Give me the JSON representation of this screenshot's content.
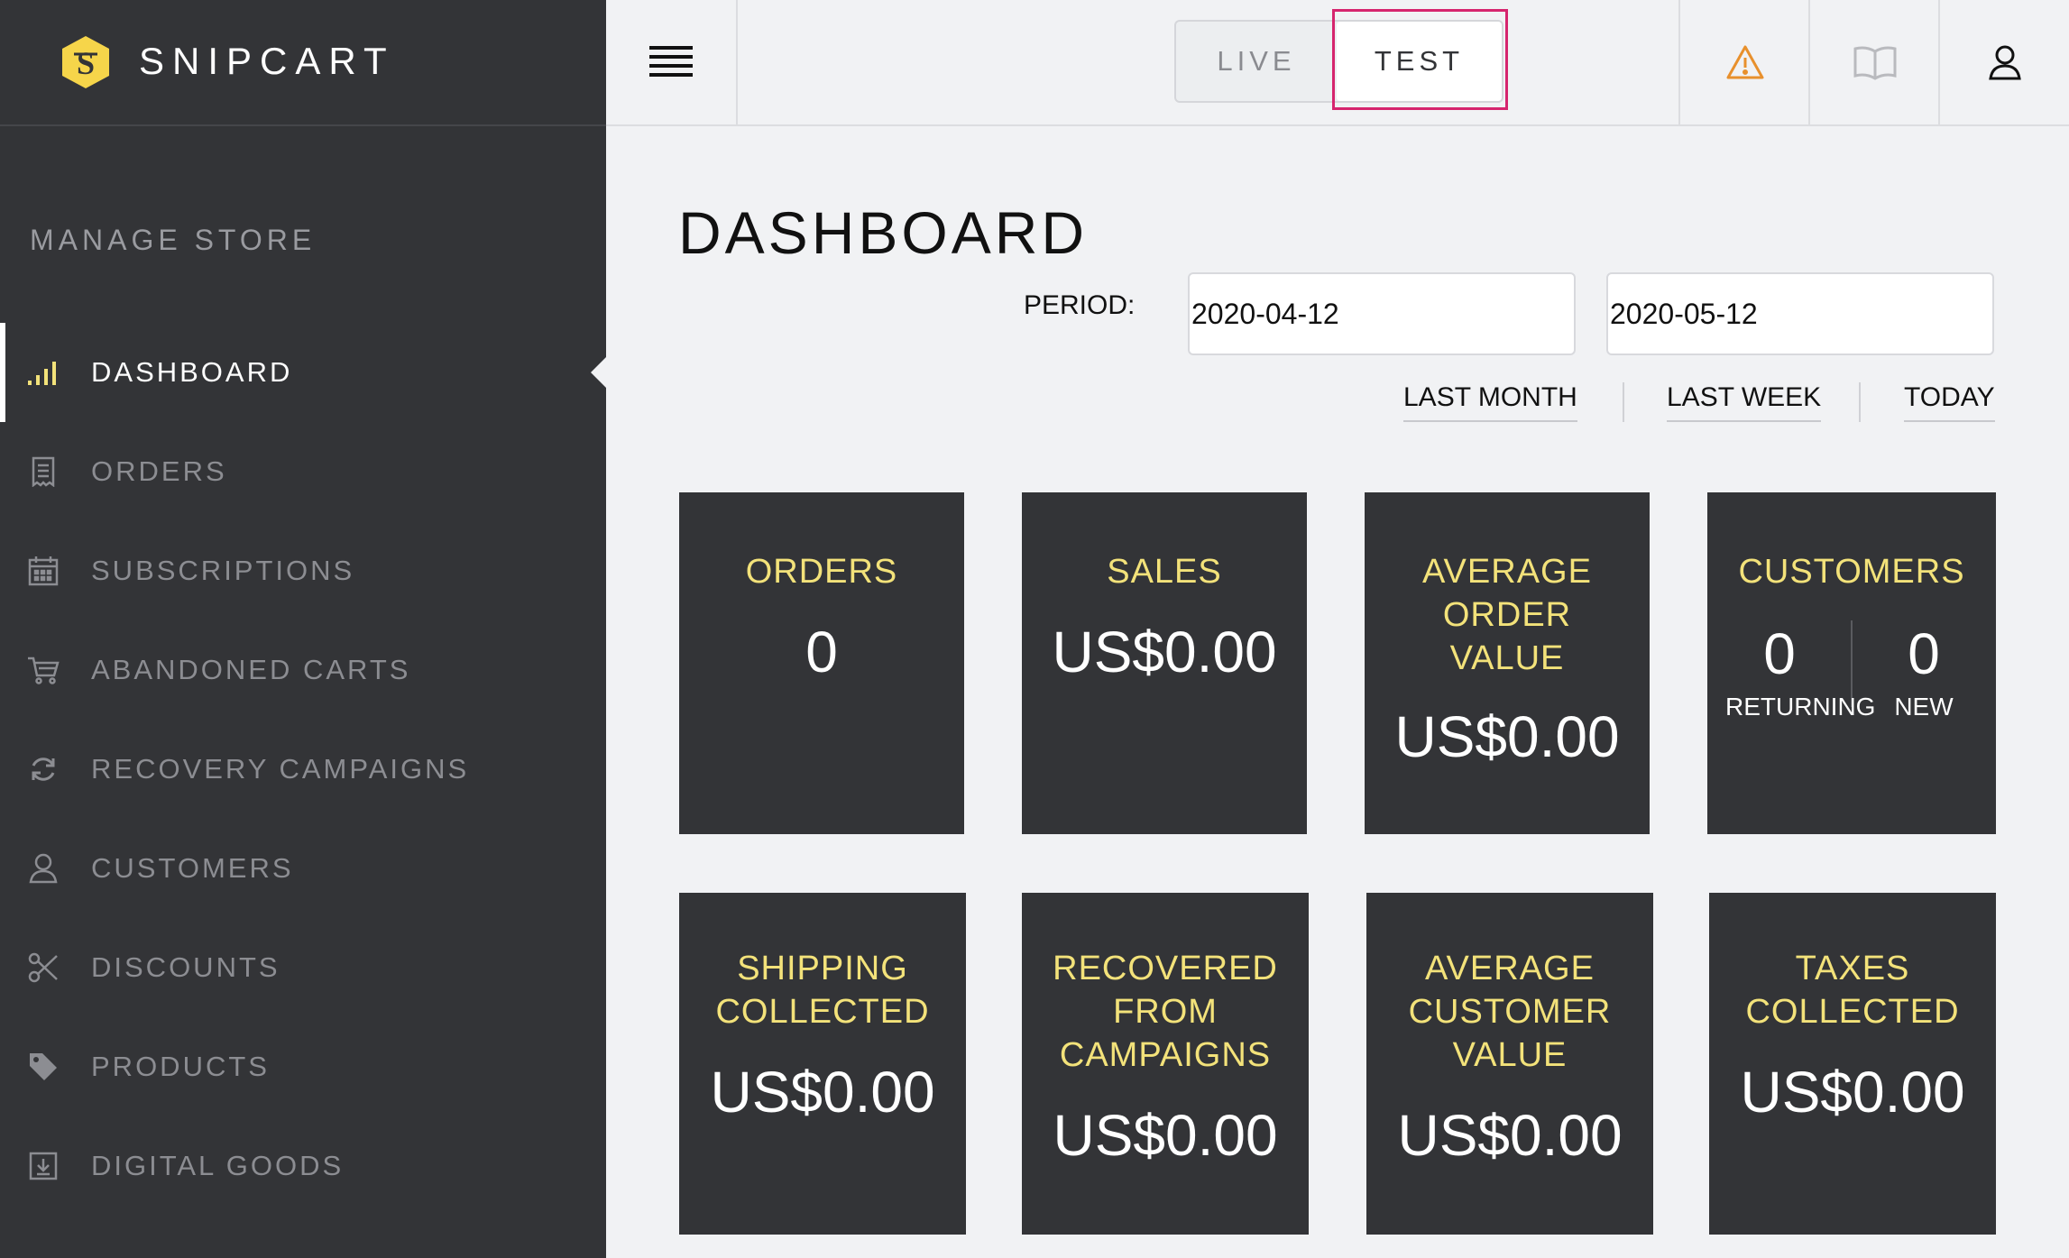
{
  "brand": {
    "name": "SNIPCART"
  },
  "sidebar": {
    "section_title": "MANAGE STORE",
    "items": [
      {
        "label": "DASHBOARD",
        "icon": "bar-chart-icon",
        "active": true
      },
      {
        "label": "ORDERS",
        "icon": "receipt-icon"
      },
      {
        "label": "SUBSCRIPTIONS",
        "icon": "calendar-icon"
      },
      {
        "label": "ABANDONED CARTS",
        "icon": "cart-icon"
      },
      {
        "label": "RECOVERY CAMPAIGNS",
        "icon": "refresh-icon"
      },
      {
        "label": "CUSTOMERS",
        "icon": "user-icon"
      },
      {
        "label": "DISCOUNTS",
        "icon": "scissors-icon"
      },
      {
        "label": "PRODUCTS",
        "icon": "tag-icon"
      },
      {
        "label": "DIGITAL GOODS",
        "icon": "download-icon"
      }
    ]
  },
  "topbar": {
    "env_live": "LIVE",
    "env_test": "TEST",
    "selected_env": "TEST"
  },
  "colors": {
    "sidebar_bg": "#333437",
    "accent_yellow": "#f3e27a",
    "logo_yellow": "#f6d54a",
    "warning_orange": "#e8902c",
    "highlight_pink": "#d6256e"
  },
  "main": {
    "title": "DASHBOARD",
    "period_label": "PERIOD:",
    "date_from": "2020-04-12",
    "date_to": "2020-05-12",
    "quick_links": [
      "LAST MONTH",
      "LAST WEEK",
      "TODAY"
    ]
  },
  "cards": {
    "orders": {
      "title": "ORDERS",
      "value": "0"
    },
    "sales": {
      "title": "SALES",
      "value": "US$0.00"
    },
    "avg_order": {
      "title_l1": "AVERAGE",
      "title_l2": "ORDER",
      "title_l3": "VALUE",
      "value": "US$0.00"
    },
    "customers": {
      "title": "CUSTOMERS",
      "returning_value": "0",
      "returning_label": "RETURNING",
      "new_value": "0",
      "new_label": "NEW"
    },
    "shipping": {
      "title_l1": "SHIPPING",
      "title_l2": "COLLECTED",
      "value": "US$0.00"
    },
    "recovered": {
      "title_l1": "RECOVERED",
      "title_l2": "FROM",
      "title_l3": "CAMPAIGNS",
      "value": "US$0.00"
    },
    "avg_customer": {
      "title_l1": "AVERAGE",
      "title_l2": "CUSTOMER",
      "title_l3": "VALUE",
      "value": "US$0.00"
    },
    "taxes": {
      "title_l1": "TAXES",
      "title_l2": "COLLECTED",
      "value": "US$0.00"
    }
  }
}
